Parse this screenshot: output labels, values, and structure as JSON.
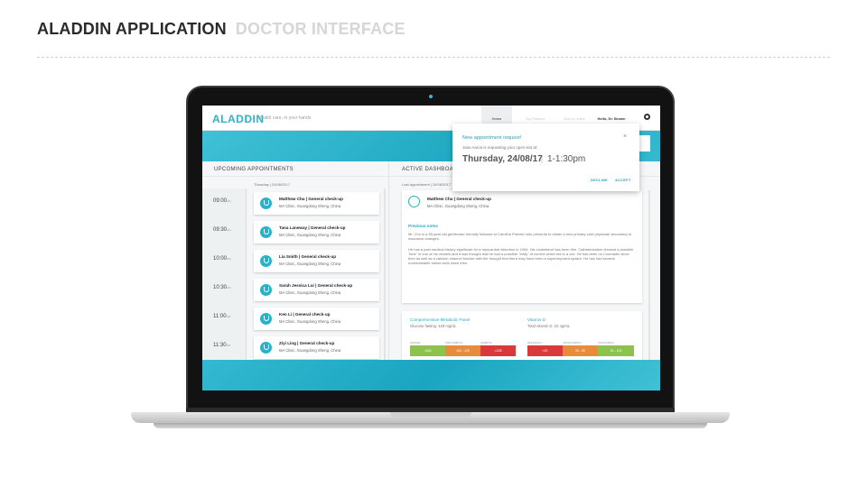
{
  "slide": {
    "title": "ALADDIN APPLICATION",
    "subtitle": "DOCTOR INTERFACE"
  },
  "app": {
    "logo": "ALADDIN",
    "tagline": "Health care, in your hands",
    "nav": {
      "home": "Home",
      "item1": "My Patients",
      "item2": "Who is online",
      "user": "Hello, Dr. Brown"
    },
    "settings_icon": "gear-icon"
  },
  "upcoming": {
    "title": "UPCOMING APPOINTMENTS",
    "day": "Thursday  |  24/08/2017",
    "items": [
      {
        "time": "09:00",
        "ampm": "AM",
        "name": "Matthew Chu | General check-up",
        "location": "MA Clinic, Guangdong Sheng, China"
      },
      {
        "time": "09:30",
        "ampm": "AM",
        "name": "Tana Laneway | General check-up",
        "location": "MA Clinic, Guangdong Sheng, China"
      },
      {
        "time": "10:00",
        "ampm": "AM",
        "name": "Lia Smith | General check-up",
        "location": "MA Clinic, Guangdong Sheng, China"
      },
      {
        "time": "10:30",
        "ampm": "AM",
        "name": "Sarah Jessica Lui | General check-up",
        "location": "MA Clinic, Guangdong Sheng, China"
      },
      {
        "time": "11:00",
        "ampm": "AM",
        "name": "Ken Li | General check-up",
        "location": "MA Clinic, Guangdong Sheng, China"
      },
      {
        "time": "11:30",
        "ampm": "AM",
        "name": "Ziyi Ling | General check-up",
        "location": "MA Clinic, Guangdong Sheng, China"
      }
    ]
  },
  "dashboard": {
    "title": "ACTIVE DASHBOARD",
    "last_appointment": "Last appointment  |  24/08/2017",
    "patient_name": "Matthew Chu | General check-up",
    "patient_location": "MA Clinic, Guangdong Sheng, China",
    "notes_title": "Previous notes",
    "note1": "Mr. Chu is a 55-year-old gentleman formally followed at Carolina Premier who presents to obtain a new primary care physician secondary to insurance changes.",
    "note2": "He has a past medical history significant for a myocardial infarction in 1994. His cholesterol has been fine. Catheterization showed a possible \"kink\" in one of his vessels and it was thought that he had a possible \"eddy\" of current which led to a clot. He has been on Coumadin since then as well as a calcium channel blocker with the thought that there may have been a superimposed spasm. He has had several unremarkable stress tests since then.",
    "lab1_title": "Comprehensive Metabolic Panel",
    "lab1_value": "Glucose fasting: 128 mg/dL",
    "lab2_title": "Vitamin D",
    "lab2_value": "Total vitamin D: 22 ng/mL",
    "lab1_segments": [
      {
        "label": "NORMAL",
        "range": "<100",
        "color": "#8ec24f"
      },
      {
        "label": "PRE-DIABETIC",
        "range": "100 - 125",
        "color": "#e88b3a"
      },
      {
        "label": "DIABETIC",
        "range": ">125",
        "color": "#d9393a"
      }
    ],
    "lab2_segments": [
      {
        "label": "DEFICIENCY",
        "range": "<20",
        "color": "#d9393a"
      },
      {
        "label": "INSUFFICIENCY",
        "range": "20 - 30",
        "color": "#e88b3a"
      },
      {
        "label": "SUFFICIENCY",
        "range": "30 - 100",
        "color": "#8ec24f"
      }
    ]
  },
  "popup": {
    "title": "New appointment request!",
    "message": "Jane Aaron is requesting your open slot at:",
    "date": "Thursday, 24/08/17",
    "separator": "|",
    "time": "1-1:30pm",
    "decline": "DECLINE",
    "accept": "ACCEPT",
    "close": "×"
  },
  "colors": {
    "accent": "#2bb3c9",
    "dark": "#2b2b2b",
    "muted": "#d6d6d6"
  }
}
